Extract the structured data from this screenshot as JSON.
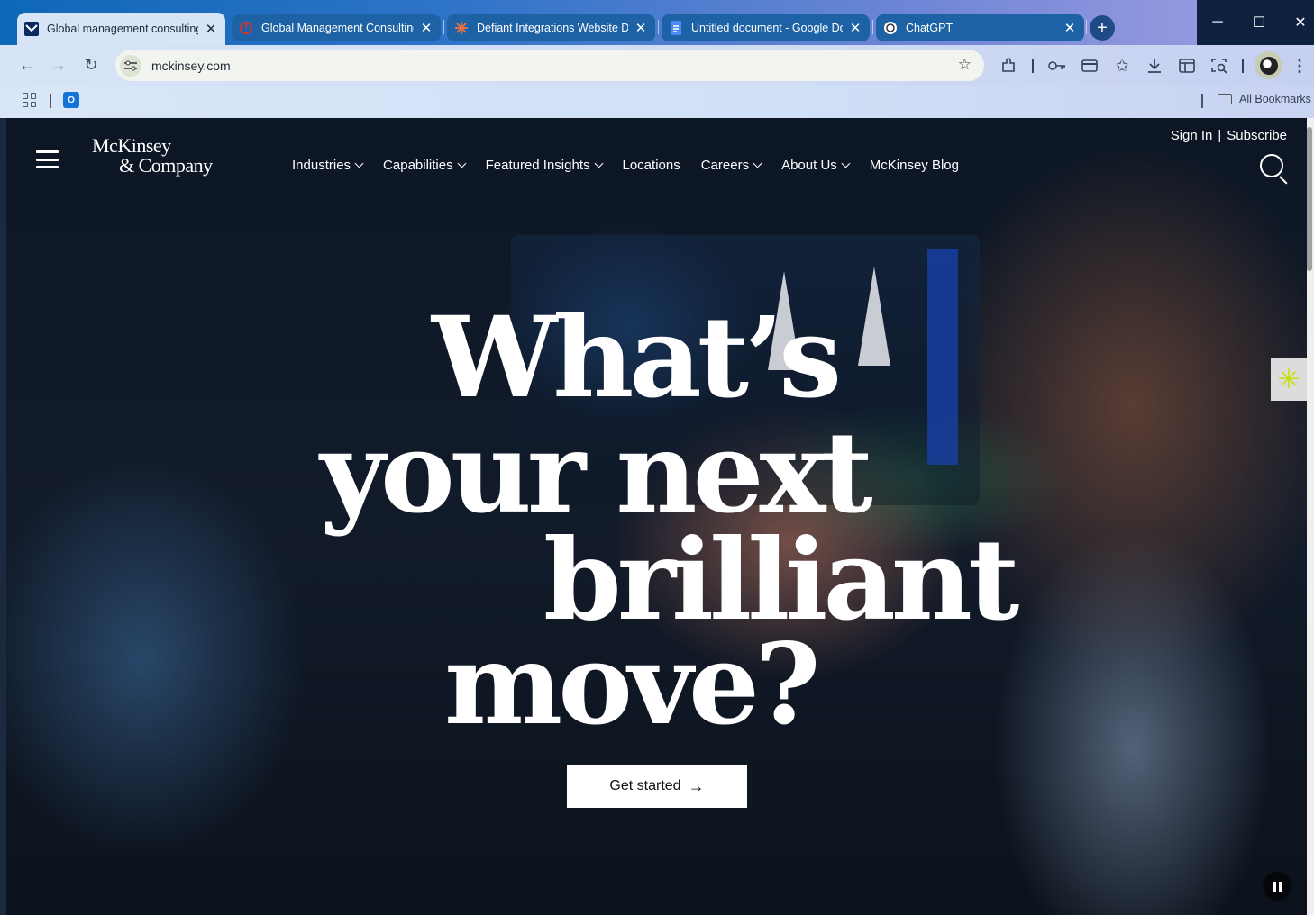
{
  "browser": {
    "tabs": [
      {
        "title": "Global management consulting",
        "active": true,
        "favicon": "mckinsey-icon"
      },
      {
        "title": "Global Management Consulting",
        "active": false,
        "favicon": "power-icon"
      },
      {
        "title": "Defiant Integrations Website De",
        "active": false,
        "favicon": "claude-icon"
      },
      {
        "title": "Untitled document - Google Do",
        "active": false,
        "favicon": "docs-icon"
      },
      {
        "title": "ChatGPT",
        "active": false,
        "favicon": "openai-icon"
      }
    ],
    "url": "mckinsey.com",
    "all_bookmarks_label": "All Bookmarks",
    "outlook_label": "O"
  },
  "site": {
    "logo_line1": "McKinsey",
    "logo_line2": "& Company",
    "nav": [
      {
        "label": "Industries",
        "has_menu": true
      },
      {
        "label": "Capabilities",
        "has_menu": true
      },
      {
        "label": "Featured Insights",
        "has_menu": true
      },
      {
        "label": "Locations",
        "has_menu": false
      },
      {
        "label": "Careers",
        "has_menu": true
      },
      {
        "label": "About Us",
        "has_menu": true
      },
      {
        "label": "McKinsey Blog",
        "has_menu": false
      }
    ],
    "sign_in": "Sign In",
    "separator": "|",
    "subscribe": "Subscribe",
    "hero": {
      "line1": "What’s",
      "line2": "your next",
      "line3": "brilliant",
      "line4": "move?"
    },
    "cta_label": "Get started",
    "cta_arrow": "→"
  },
  "colors": {
    "chrome_accent": "#0e67b8",
    "page_bg": "#0c1624",
    "widget_accent": "#c8e000"
  }
}
